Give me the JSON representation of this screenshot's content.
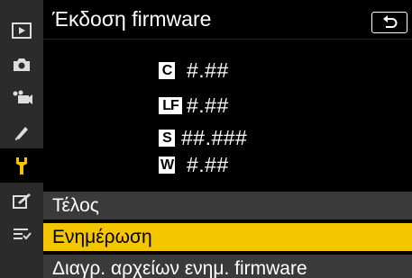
{
  "tabs": [
    {
      "name": "playback-menu",
      "icon": "play-icon"
    },
    {
      "name": "photo-shooting-menu",
      "icon": "camera-icon"
    },
    {
      "name": "movie-shooting-menu",
      "icon": "movie-camera-icon"
    },
    {
      "name": "custom-settings-menu",
      "icon": "pencil-icon"
    },
    {
      "name": "setup-menu",
      "icon": "wrench-icon",
      "active": true
    },
    {
      "name": "retouch-menu",
      "icon": "retouch-icon"
    },
    {
      "name": "my-menu",
      "icon": "my-menu-list-icon"
    }
  ],
  "header": {
    "title": "Έκδοση firmware",
    "back_icon": "return-arrow-icon"
  },
  "firmware": [
    {
      "badge": "C",
      "value": "#.##"
    },
    {
      "badge": "LF",
      "value": "#.##"
    },
    {
      "badge": "S",
      "value": "##.###"
    },
    {
      "badge": "W",
      "value": "#.##"
    }
  ],
  "menu": [
    {
      "label": "Τέλος",
      "selected": false
    },
    {
      "label": "Ενημέρωση",
      "selected": true
    },
    {
      "label": "Διαγρ. αρχείων ενημ. firmware",
      "selected": false
    }
  ],
  "colors": {
    "selection": "#f5c500",
    "rail_bg": "#2b2b2b",
    "item_bg": "#3a3a3a"
  }
}
